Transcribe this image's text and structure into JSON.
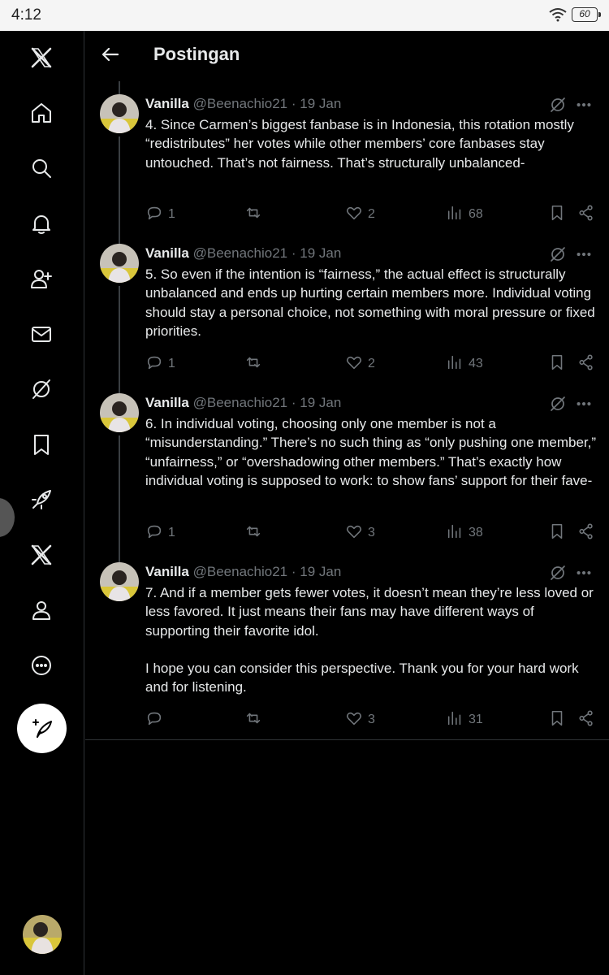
{
  "status_bar": {
    "time": "4:12",
    "battery": "60"
  },
  "header": {
    "title": "Postingan"
  },
  "sidebar": {
    "items": [
      "x-logo",
      "home",
      "search",
      "notifications",
      "follow",
      "messages",
      "grok",
      "bookmarks",
      "rocket",
      "premium-x",
      "profile",
      "more"
    ]
  },
  "posts": [
    {
      "name": "Vanilla",
      "handle": "@Beenachio21",
      "dot": "·",
      "date": "19 Jan",
      "text": "4. Since Carmen’s biggest fanbase is in Indonesia, this rotation mostly “redistributes” her votes while other members’ core fanbases stay untouched. That’s not fairness. That’s structurally unbalanced-",
      "replies": "1",
      "reposts": "",
      "likes": "2",
      "views": "68"
    },
    {
      "name": "Vanilla",
      "handle": "@Beenachio21",
      "dot": "·",
      "date": "19 Jan",
      "text": "5. So even if the intention is “fairness,” the actual effect is structurally unbalanced and ends up hurting certain members more. Individual voting should stay a personal choice, not something with moral pressure or fixed priorities.",
      "replies": "1",
      "reposts": "",
      "likes": "2",
      "views": "43"
    },
    {
      "name": "Vanilla",
      "handle": "@Beenachio21",
      "dot": "·",
      "date": "19 Jan",
      "text": "6. In individual voting, choosing only one member is not a “misunderstanding.” There’s no such thing as “only pushing one member,” “unfairness,” or “overshadowing other members.” That’s exactly how individual voting is supposed to work: to show fans’ support for their fave-",
      "replies": "1",
      "reposts": "",
      "likes": "3",
      "views": "38"
    },
    {
      "name": "Vanilla",
      "handle": "@Beenachio21",
      "dot": "·",
      "date": "19 Jan",
      "text": "7. And if a member gets fewer votes, it doesn’t mean they’re less loved or less favored. It just means their fans may have different ways of supporting their favorite idol.\n\nI hope you can consider this perspective. Thank you for your hard work and for listening.",
      "replies": "",
      "reposts": "",
      "likes": "3",
      "views": "31"
    }
  ],
  "colors": {
    "background": "#000000",
    "text": "#e7e9ea",
    "muted": "#71767b",
    "border": "#2f3336"
  }
}
